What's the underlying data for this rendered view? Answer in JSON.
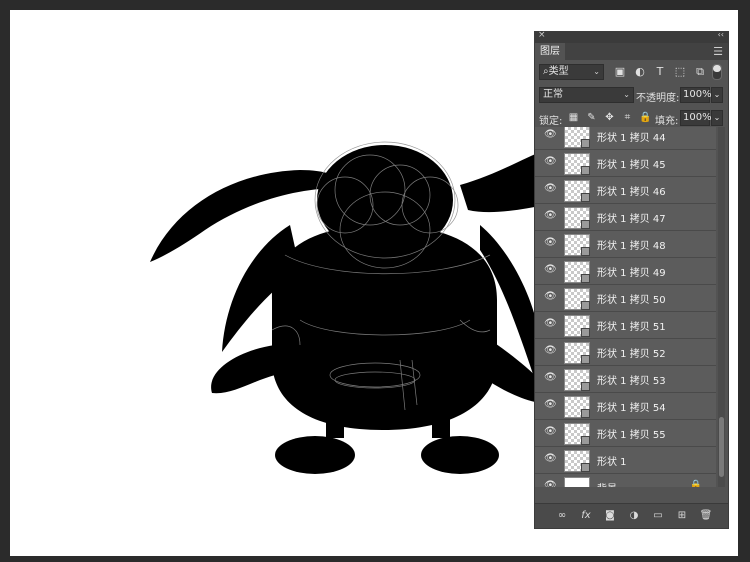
{
  "panel": {
    "close_glyph": "×",
    "collapse_glyph": "‹‹",
    "tab_label": "图层",
    "menu_glyph": "☰",
    "filter": {
      "search_glyph": "⌕",
      "type_label": "类型",
      "icons": [
        "image-filter-icon",
        "adjustment-filter-icon",
        "type-filter-icon",
        "shape-filter-icon",
        "smart-object-filter-icon"
      ]
    },
    "blend": {
      "mode": "正常",
      "opacity_label": "不透明度:",
      "opacity_value": "100%"
    },
    "lock": {
      "label": "锁定:",
      "fill_label": "填充:",
      "fill_value": "100%"
    },
    "layers": [
      {
        "name": "形状 1 拷贝 44",
        "type": "shape"
      },
      {
        "name": "形状 1 拷贝 45",
        "type": "shape"
      },
      {
        "name": "形状 1 拷贝 46",
        "type": "shape"
      },
      {
        "name": "形状 1 拷贝 47",
        "type": "shape"
      },
      {
        "name": "形状 1 拷贝 48",
        "type": "shape"
      },
      {
        "name": "形状 1 拷贝 49",
        "type": "shape"
      },
      {
        "name": "形状 1 拷贝 50",
        "type": "shape"
      },
      {
        "name": "形状 1 拷贝 51",
        "type": "shape"
      },
      {
        "name": "形状 1 拷贝 52",
        "type": "shape"
      },
      {
        "name": "形状 1 拷贝 53",
        "type": "shape"
      },
      {
        "name": "形状 1 拷贝 54",
        "type": "shape"
      },
      {
        "name": "形状 1 拷贝 55",
        "type": "shape"
      },
      {
        "name": "形状 1",
        "type": "shape"
      },
      {
        "name": "背景",
        "type": "background"
      }
    ],
    "footer_icons": [
      "link-layers-icon",
      "fx-icon",
      "add-mask-icon",
      "adjustment-layer-icon",
      "new-group-icon",
      "new-layer-icon",
      "delete-layer-icon"
    ]
  },
  "colors": {
    "workspace": "#2b2b2b",
    "canvas": "#ffffff",
    "panel": "#535353",
    "layer_row": "#5c5c5c"
  }
}
